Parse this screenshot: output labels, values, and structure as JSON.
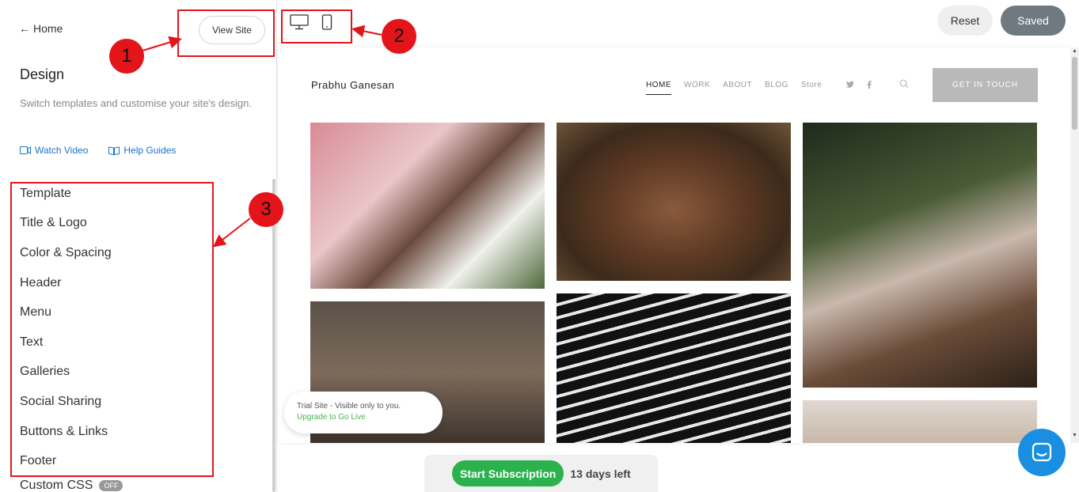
{
  "sidebar": {
    "home_label": "Home",
    "view_site_label": "View Site",
    "title": "Design",
    "description": "Switch templates and customise your site's design.",
    "watch_video_label": "Watch Video",
    "help_guides_label": "Help Guides",
    "menu_items": [
      {
        "label": "Template"
      },
      {
        "label": "Title & Logo"
      },
      {
        "label": "Color & Spacing"
      },
      {
        "label": "Header"
      },
      {
        "label": "Menu"
      },
      {
        "label": "Text"
      },
      {
        "label": "Galleries"
      },
      {
        "label": "Social Sharing"
      },
      {
        "label": "Buttons & Links"
      },
      {
        "label": "Footer"
      },
      {
        "label": "Custom CSS",
        "badge": "OFF"
      }
    ]
  },
  "topbar": {
    "devices": [
      "desktop-icon",
      "mobile-icon"
    ],
    "reset_label": "Reset",
    "saved_label": "Saved"
  },
  "preview": {
    "site_name": "Prabhu Ganesan",
    "nav": [
      {
        "label": "HOME",
        "active": true
      },
      {
        "label": "WORK"
      },
      {
        "label": "ABOUT"
      },
      {
        "label": "BLOG"
      },
      {
        "label": "Store"
      }
    ],
    "social_icons": [
      "twitter-icon",
      "facebook-icon"
    ],
    "cta_label": "GET IN TOUCH",
    "gallery_count": 6
  },
  "trial": {
    "line1": "Trial Site - Visible only to you.",
    "line2": "Upgrade to Go Live"
  },
  "subscription": {
    "button_label": "Start Subscription",
    "days_left": "13 days left"
  },
  "annotations": [
    "1",
    "2",
    "3"
  ],
  "colors": {
    "annotation_red": "#e3151a",
    "link_blue": "#1a73c8",
    "saved_gray": "#6f7a80",
    "subscribe_green": "#2bb24c",
    "chat_blue": "#1a8ee0"
  }
}
